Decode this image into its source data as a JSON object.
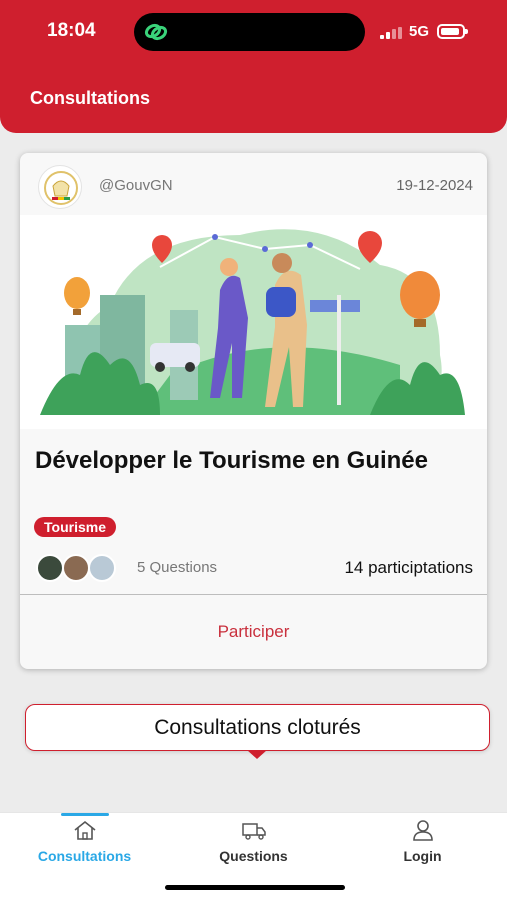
{
  "status_bar": {
    "time": "18:04",
    "network": "5G"
  },
  "header": {
    "title": "Consultations"
  },
  "consultation": {
    "author": "@GouvGN",
    "date": "19-12-2024",
    "title": "Développer le Tourisme en Guinée",
    "tag": "Tourisme",
    "questions": "5 Questions",
    "participations": "14 participtations",
    "action_label": "Participer"
  },
  "closed_button": {
    "label": "Consultations cloturés"
  },
  "tabbar": {
    "items": [
      {
        "label": "Consultations",
        "icon": "home-icon",
        "active": true
      },
      {
        "label": "Questions",
        "icon": "truck-icon",
        "active": false
      },
      {
        "label": "Login",
        "icon": "user-icon",
        "active": false
      }
    ]
  },
  "colors": {
    "brand_red": "#cf1f2e",
    "active_tab": "#2aa8e6"
  }
}
